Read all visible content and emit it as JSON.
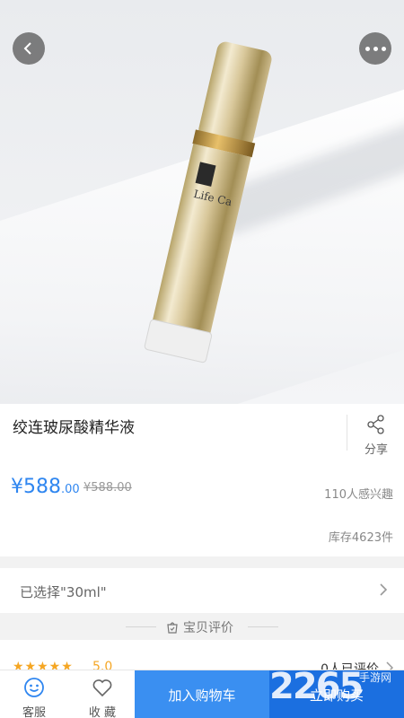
{
  "product": {
    "title": "绞连玻尿酸精华液",
    "price_main": "¥588",
    "price_cents": ".00",
    "old_price": "¥588.00",
    "interest": "110人感兴趣",
    "stock": "库存4623件",
    "bottle_label": "Life Ca",
    "share_label": "分享"
  },
  "selection": {
    "label": "已选择\"30ml\""
  },
  "reviews": {
    "section_title": "宝贝评价",
    "stars": "★★★★★",
    "rating": "5.0",
    "count": "0人已评价"
  },
  "bottom_bar": {
    "service_label": "客服",
    "favorite_label": "收 藏",
    "add_cart_label": "加入购物车",
    "buy_now_label": "立即购买"
  },
  "watermark": {
    "brand_num": "2265",
    "brand_text": "手游网"
  },
  "colors": {
    "accent": "#2f86f0",
    "star": "#f5a623",
    "cart_button": "#3a8ff1",
    "buy_button": "#1b6fe0"
  },
  "icons": [
    "back-arrow-icon",
    "more-dots-icon",
    "share-icon",
    "chevron-right-icon",
    "bag-check-icon",
    "customer-service-icon",
    "heart-icon"
  ]
}
